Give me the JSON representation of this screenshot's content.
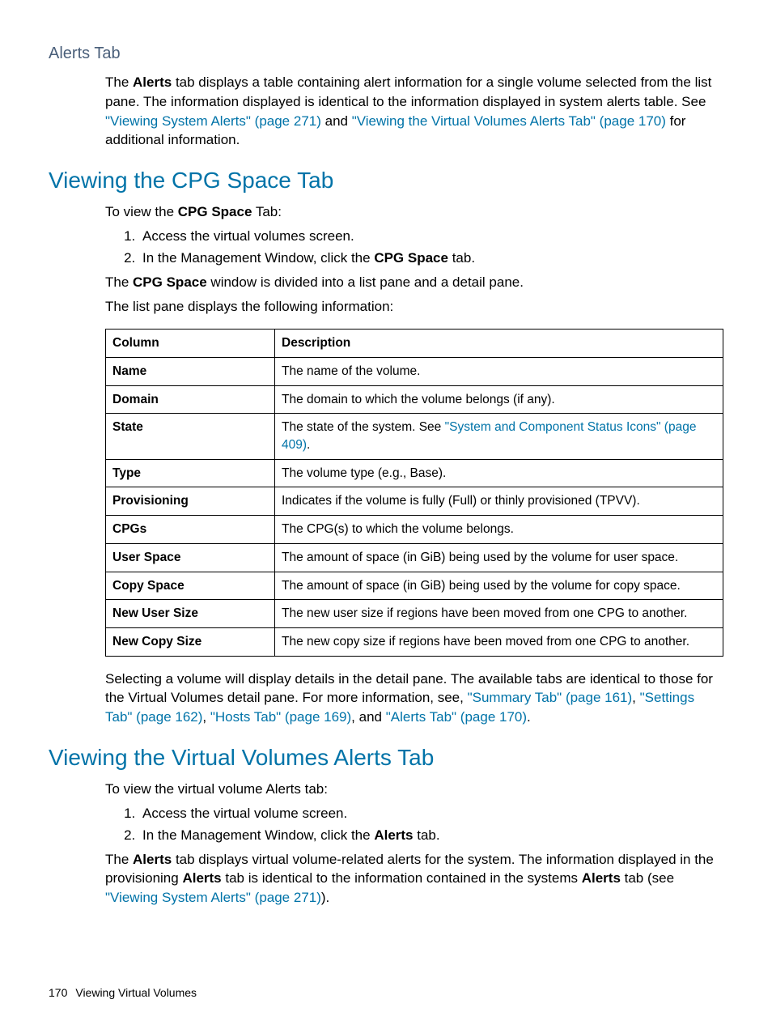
{
  "section_alerts": {
    "heading": "Alerts Tab",
    "p1_a": "The ",
    "p1_b": "Alerts",
    "p1_c": " tab displays a table containing alert information for a single volume selected from the list pane. The information displayed is identical to the information displayed in system alerts table. See ",
    "link1": "\"Viewing System Alerts\" (page 271)",
    "p1_d": " and ",
    "link2": "\"Viewing the Virtual Volumes Alerts Tab\" (page 170)",
    "p1_e": " for additional information."
  },
  "section_cpg": {
    "heading": "Viewing the CPG Space Tab",
    "intro_a": "To view the ",
    "intro_b": "CPG Space",
    "intro_c": " Tab:",
    "step1": "Access the virtual volumes screen.",
    "step2_a": "In the Management Window, click the ",
    "step2_b": "CPG Space",
    "step2_c": " tab.",
    "p2_a": "The ",
    "p2_b": "CPG Space",
    "p2_c": " window is divided into a list pane and a detail pane.",
    "p3": "The list pane displays the following information:",
    "th1": "Column",
    "th2": "Description",
    "rows": [
      {
        "c": "Name",
        "d": "The name of the volume."
      },
      {
        "c": "Domain",
        "d": "The domain to which the volume belongs (if any)."
      },
      {
        "c": "State",
        "d": "The state of the system. See ",
        "link": "\"System and Component Status Icons\" (page 409)",
        "d2": "."
      },
      {
        "c": "Type",
        "d": "The volume type (e.g., Base)."
      },
      {
        "c": "Provisioning",
        "d": "Indicates if the volume is fully (Full) or thinly provisioned (TPVV)."
      },
      {
        "c": "CPGs",
        "d": "The CPG(s) to which the volume belongs."
      },
      {
        "c": "User Space",
        "d": "The amount of space (in GiB) being used by the volume for user space."
      },
      {
        "c": "Copy Space",
        "d": "The amount of space (in GiB) being used by the volume for copy space."
      },
      {
        "c": "New User Size",
        "d": "The new user size if regions have been moved from one CPG to another."
      },
      {
        "c": "New Copy Size",
        "d": "The new copy size if regions have been moved from one CPG to another."
      }
    ],
    "after_a": "Selecting a volume will display details in the detail pane. The available tabs are identical to those for the Virtual Volumes detail pane. For more information, see, ",
    "link_a": "\"Summary Tab\" (page 161)",
    "after_b": ", ",
    "link_b": "\"Settings Tab\" (page 162)",
    "after_c": ", ",
    "link_c": "\"Hosts Tab\" (page 169)",
    "after_d": ", and ",
    "link_d": "\"Alerts Tab\" (page 170)",
    "after_e": "."
  },
  "section_vv": {
    "heading": "Viewing the Virtual Volumes Alerts Tab",
    "intro": "To view the virtual volume Alerts tab:",
    "step1": "Access the virtual volume screen.",
    "step2_a": "In the Management Window, click the ",
    "step2_b": "Alerts",
    "step2_c": " tab.",
    "p_a": "The ",
    "p_b": "Alerts",
    "p_c": " tab displays virtual volume-related alerts for the system. The information displayed in the provisioning ",
    "p_d": "Alerts",
    "p_e": " tab is identical to the information contained in the systems ",
    "p_f": "Alerts",
    "p_g": " tab (see ",
    "link": "\"Viewing System Alerts\" (page 271)",
    "p_h": ")."
  },
  "footer": {
    "page": "170",
    "title": "Viewing Virtual Volumes"
  }
}
